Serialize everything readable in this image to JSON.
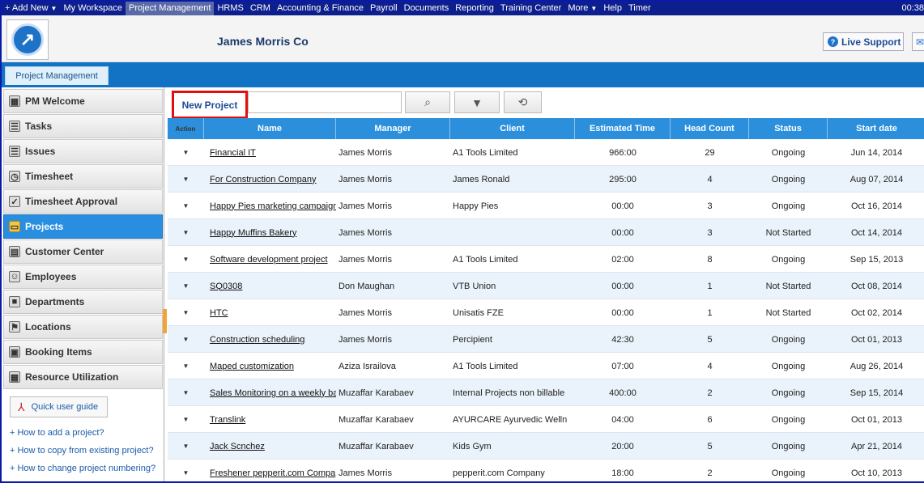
{
  "topbar": {
    "items": [
      {
        "label": "+ Add New",
        "caret": true
      },
      {
        "label": "My Workspace"
      },
      {
        "label": "Project Management",
        "active": true
      },
      {
        "label": "HRMS"
      },
      {
        "label": "CRM"
      },
      {
        "label": "Accounting & Finance"
      },
      {
        "label": "Payroll"
      },
      {
        "label": "Documents"
      },
      {
        "label": "Reporting"
      },
      {
        "label": "Training Center"
      },
      {
        "label": "More",
        "caret": true
      },
      {
        "label": "Help"
      },
      {
        "label": "Timer"
      }
    ],
    "clock": "00:38"
  },
  "header": {
    "company": "James Morris Co",
    "live_support": "Live Support"
  },
  "tabs": {
    "active": "Project Management"
  },
  "sidebar": {
    "items": [
      {
        "label": "PM Welcome",
        "icon": "dashboard-icon",
        "glyph": "▦"
      },
      {
        "label": "Tasks",
        "icon": "tasks-icon",
        "glyph": "☰"
      },
      {
        "label": "Issues",
        "icon": "issues-icon",
        "glyph": "☰"
      },
      {
        "label": "Timesheet",
        "icon": "clock-icon",
        "glyph": "◷"
      },
      {
        "label": "Timesheet Approval",
        "icon": "approval-icon",
        "glyph": "✓"
      },
      {
        "label": "Projects",
        "icon": "folder-icon",
        "glyph": "▭",
        "active": true
      },
      {
        "label": "Customer Center",
        "icon": "customer-icon",
        "glyph": "▤"
      },
      {
        "label": "Employees",
        "icon": "employees-icon",
        "glyph": "☺"
      },
      {
        "label": "Departments",
        "icon": "departments-icon",
        "glyph": "■"
      },
      {
        "label": "Locations",
        "icon": "flag-icon",
        "glyph": "⚑"
      },
      {
        "label": "Booking Items",
        "icon": "booking-icon",
        "glyph": "▣"
      },
      {
        "label": "Resource Utilization",
        "icon": "resource-icon",
        "glyph": "▦"
      }
    ],
    "guide": "Quick user guide",
    "links": [
      "+ How to add a project?",
      "+ How to copy from existing project?",
      "+ How to change project numbering?"
    ]
  },
  "toolbar": {
    "new_project": "New Project",
    "search_value": ""
  },
  "table": {
    "columns": [
      "Action",
      "Name",
      "Manager",
      "Client",
      "Estimated Time",
      "Head Count",
      "Status",
      "Start date"
    ],
    "rows": [
      {
        "name": "Financial IT",
        "manager": "James Morris",
        "client": "A1 Tools Limited",
        "time": "966:00",
        "head": "29",
        "status": "Ongoing",
        "start": "Jun 14, 2014"
      },
      {
        "name": "For Construction Company",
        "manager": "James Morris",
        "client": "James Ronald",
        "time": "295:00",
        "head": "4",
        "status": "Ongoing",
        "start": "Aug 07, 2014"
      },
      {
        "name": "Happy Pies marketing campaign",
        "manager": "James Morris",
        "client": "Happy Pies",
        "time": "00:00",
        "head": "3",
        "status": "Ongoing",
        "start": "Oct 16, 2014"
      },
      {
        "name": "Happy Muffins Bakery",
        "manager": "James Morris",
        "client": "",
        "time": "00:00",
        "head": "3",
        "status": "Not Started",
        "start": "Oct 14, 2014"
      },
      {
        "name": "Software development project",
        "manager": "James Morris",
        "client": "A1 Tools Limited",
        "time": "02:00",
        "head": "8",
        "status": "Ongoing",
        "start": "Sep 15, 2013"
      },
      {
        "name": "SQ0308",
        "manager": "Don Maughan",
        "client": "VTB Union",
        "time": "00:00",
        "head": "1",
        "status": "Not Started",
        "start": "Oct 08, 2014"
      },
      {
        "name": "HTC",
        "manager": "James Morris",
        "client": "Unisatis FZE",
        "time": "00:00",
        "head": "1",
        "status": "Not Started",
        "start": "Oct 02, 2014"
      },
      {
        "name": "Construction scheduling",
        "manager": "James Morris",
        "client": "Percipient",
        "time": "42:30",
        "head": "5",
        "status": "Ongoing",
        "start": "Oct 01, 2013"
      },
      {
        "name": "Maped customization",
        "manager": "Aziza Israilova",
        "client": "A1 Tools Limited",
        "time": "07:00",
        "head": "4",
        "status": "Ongoing",
        "start": "Aug 26, 2014"
      },
      {
        "name": "Sales Monitoring on a weekly ba",
        "manager": "Muzaffar Karabaev",
        "client": "Internal Projects non billable",
        "time": "400:00",
        "head": "2",
        "status": "Ongoing",
        "start": "Sep 15, 2014"
      },
      {
        "name": "Translink",
        "manager": "Muzaffar Karabaev",
        "client": "AYURCARE Ayurvedic Welln",
        "time": "04:00",
        "head": "6",
        "status": "Ongoing",
        "start": "Oct 01, 2013"
      },
      {
        "name": "Jack Scnchez",
        "manager": "Muzaffar Karabaev",
        "client": "Kids Gym",
        "time": "20:00",
        "head": "5",
        "status": "Ongoing",
        "start": "Apr 21, 2014"
      },
      {
        "name": "Freshener pepperit.com Compa",
        "manager": "James Morris",
        "client": "pepperit.com Company",
        "time": "18:00",
        "head": "2",
        "status": "Ongoing",
        "start": "Oct 10, 2013"
      }
    ]
  }
}
